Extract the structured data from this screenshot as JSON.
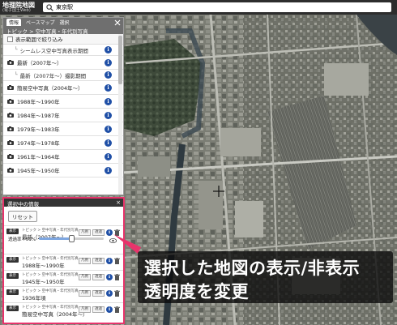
{
  "app": {
    "title": "地理院地図",
    "subtitle": "(電子国土Web)"
  },
  "search": {
    "value": "東京駅",
    "icon": "search-icon"
  },
  "layer_panel": {
    "tabs": [
      "情報",
      "ベースマップ",
      "選択"
    ],
    "breadcrumb": "トピック > 空中写真・年代別写真",
    "narrow_label": "表示範囲で絞り込み",
    "items": [
      {
        "label": "シームレス空中写真表示期間",
        "sub": true
      },
      {
        "label": "最新（2007年〜）",
        "sub": false
      },
      {
        "label": "最新（2007年〜）撮影期間",
        "sub": true
      },
      {
        "label": "簡易空中写真（2004年〜）",
        "sub": false
      },
      {
        "label": "1988年〜1990年",
        "sub": false
      },
      {
        "label": "1984年〜1987年",
        "sub": false
      },
      {
        "label": "1979年〜1983年",
        "sub": false
      },
      {
        "label": "1974年〜1978年",
        "sub": false
      },
      {
        "label": "1961年〜1964年",
        "sub": false
      },
      {
        "label": "1945年〜1950年",
        "sub": false
      }
    ]
  },
  "selected_panel": {
    "title": "選択中の情報",
    "reset_label": "リセット",
    "toggle_label": "表示",
    "btn1": "凡例",
    "btn2": "透過",
    "opacity_label": "透過率 : 51%",
    "opacity": 0.51,
    "items": [
      {
        "category": "トピック > 空中写真・年代別写真",
        "title": "最新（2007年〜）"
      },
      {
        "category": "トピック > 空中写真・年代別写真",
        "title": "1988年〜1990年"
      },
      {
        "category": "トピック > 空中写真・年代別写真",
        "title": "1945年〜1950年"
      },
      {
        "category": "トピック > 空中写真・年代別写真",
        "title": "1936年頃"
      },
      {
        "category": "トピック > 空中写真・年代別写真",
        "title": "簡易空中写真（2004年〜）"
      }
    ]
  },
  "callout": {
    "line1": "選択した地図の表示/非表示",
    "line2": "透明度を変更"
  },
  "colors": {
    "highlight": "#e8336b",
    "info_blue": "#1f4fa6",
    "header": "#2d2d2d"
  }
}
